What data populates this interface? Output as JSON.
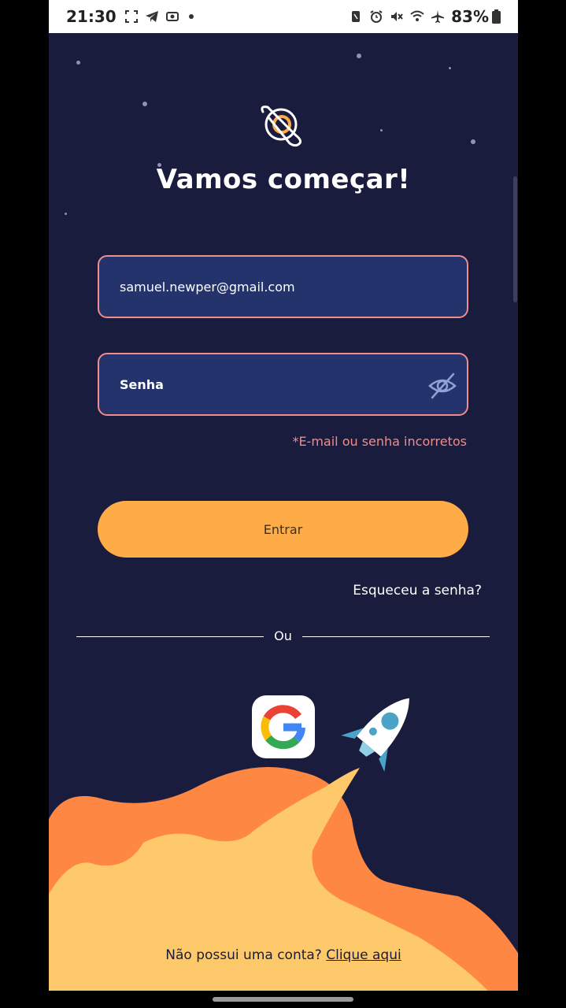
{
  "status_bar": {
    "time": "21:30",
    "battery": "83%",
    "left_icons": [
      "screenshot-icon",
      "telegram-icon",
      "screen-record-icon",
      "dot-icon"
    ],
    "right_icons": [
      "nfc-icon",
      "alarm-icon",
      "mute-icon",
      "wifi-icon",
      "airplane-icon",
      "battery-icon"
    ]
  },
  "header": {
    "title": "Vamos começar!"
  },
  "form": {
    "email_value": "samuel.newper@gmail.com",
    "password_placeholder": "Senha",
    "error_message": "*E-mail ou senha incorretos",
    "login_label": "Entrar",
    "forgot_label": "Esqueceu a senha?"
  },
  "divider": {
    "label": "Ou"
  },
  "footer": {
    "signup_text": "Não possui uma conta?",
    "signup_link": "Clique aqui"
  },
  "colors": {
    "background": "#1a1c3d",
    "field_background": "#24336b",
    "field_border": "#f08c8c",
    "error": "#f08c8c",
    "primary_button": "#fdac47",
    "flame_dark": "#fd8743",
    "flame_light": "#fdc96b"
  }
}
